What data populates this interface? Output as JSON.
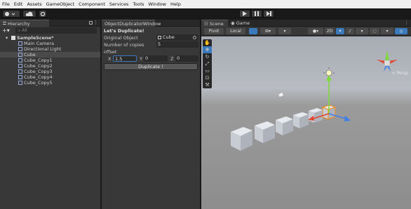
{
  "menu": [
    "File",
    "Edit",
    "Assets",
    "GameObject",
    "Component",
    "Services",
    "Tools",
    "Window",
    "Help"
  ],
  "hierarchy": {
    "tab": "Hierarchy",
    "search_placeholder": "All",
    "scene": "SampleScene*",
    "items": [
      "Main Camera",
      "Directional Light",
      "Cube",
      "Cube_Copy1",
      "Cube_Copy2",
      "Cube_Copy3",
      "Cube_Copy4",
      "Cube_Copy5"
    ],
    "selected": "Cube"
  },
  "duplicator": {
    "tab": "ObjectDuplicatorWindow",
    "title": "Let's Duplicate!",
    "original_label": "Original Object",
    "original_value": "Cube",
    "copies_label": "Number of copies",
    "copies_value": "5",
    "offset_label": "offset",
    "x_label": "X",
    "x_value": "1.5",
    "y_label": "Y",
    "y_value": "0",
    "z_label": "Z",
    "z_value": "0",
    "button": "Duplicate !"
  },
  "scene": {
    "tabs": [
      "Scene",
      "Game"
    ],
    "pivot": "Pivot",
    "local": "Local",
    "mode_2d": "2D",
    "persp": "< Persp"
  },
  "colors": {
    "accent_orange": "#f08a1c",
    "gizmo_green": "#7fd93a",
    "gizmo_red": "#e2472f",
    "gizmo_blue": "#3f7fe8"
  }
}
